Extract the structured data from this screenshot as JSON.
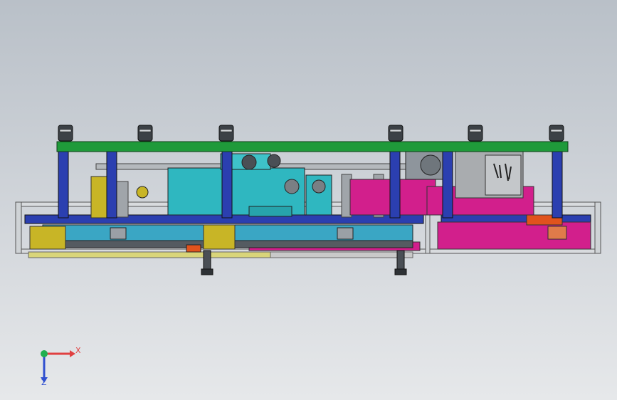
{
  "viewport": {
    "colors": {
      "frame": "#2b3fb0",
      "top_plate": "#1f9a3a",
      "carriage": "#2fb7c0",
      "conveyor": "#3aa6c4",
      "magenta_module": "#d21f8c",
      "yellow_bracket": "#c8b526",
      "steel": "#8e959c",
      "dark_steel": "#4a4f55",
      "rail": "#cfd3d6",
      "cabinet": "#a9acaf"
    }
  },
  "triad": {
    "x_label": "X",
    "z_label": "Z",
    "x_color": "#e04040",
    "y_color": "#20b050",
    "z_color": "#3050d0",
    "icon": "coordinate-triad-icon"
  }
}
